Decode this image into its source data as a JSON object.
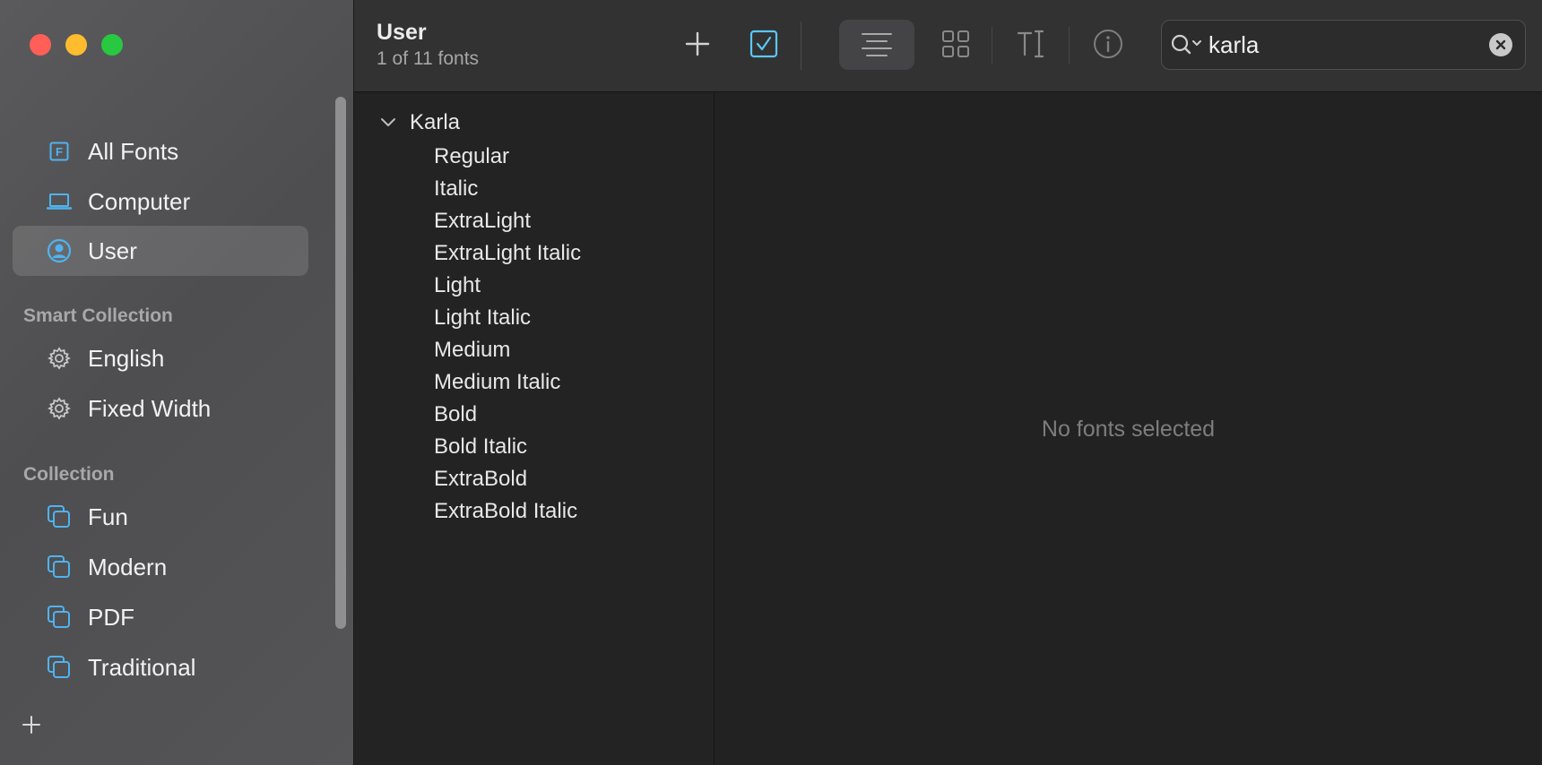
{
  "window": {
    "traffic_lights": {
      "close": "#ff5f57",
      "minimize": "#febc2e",
      "zoom": "#28c840"
    }
  },
  "sidebar": {
    "library_items": [
      {
        "label": "All Fonts",
        "icon": "font-book-icon",
        "selected": false
      },
      {
        "label": "Computer",
        "icon": "laptop-icon",
        "selected": false
      },
      {
        "label": "User",
        "icon": "user-circle-icon",
        "selected": true
      }
    ],
    "smart_collection": {
      "heading": "Smart Collection",
      "items": [
        {
          "label": "English",
          "icon": "gear-icon"
        },
        {
          "label": "Fixed Width",
          "icon": "gear-icon"
        }
      ]
    },
    "collection": {
      "heading": "Collection",
      "items": [
        {
          "label": "Fun",
          "icon": "collection-icon"
        },
        {
          "label": "Modern",
          "icon": "collection-icon"
        },
        {
          "label": "PDF",
          "icon": "collection-icon"
        },
        {
          "label": "Traditional",
          "icon": "collection-icon"
        }
      ]
    },
    "add_button_icon": "plus-icon"
  },
  "toolbar": {
    "title": "User",
    "subtitle": "1 of 11 fonts",
    "buttons": [
      "plus-icon",
      "checkbox-icon",
      "list-view-icon",
      "grid-view-icon",
      "text-cursor-icon",
      "info-icon"
    ],
    "accent": "#5ac8fa"
  },
  "search": {
    "value": "karla",
    "icon": "magnifier-dropdown-icon"
  },
  "font_list": {
    "family": "Karla",
    "expanded": true,
    "styles": [
      "Regular",
      "Italic",
      "ExtraLight",
      "ExtraLight Italic",
      "Light",
      "Light Italic",
      "Medium",
      "Medium Italic",
      "Bold",
      "Bold Italic",
      "ExtraBold",
      "ExtraBold Italic"
    ]
  },
  "preview": {
    "empty_message": "No fonts selected"
  }
}
